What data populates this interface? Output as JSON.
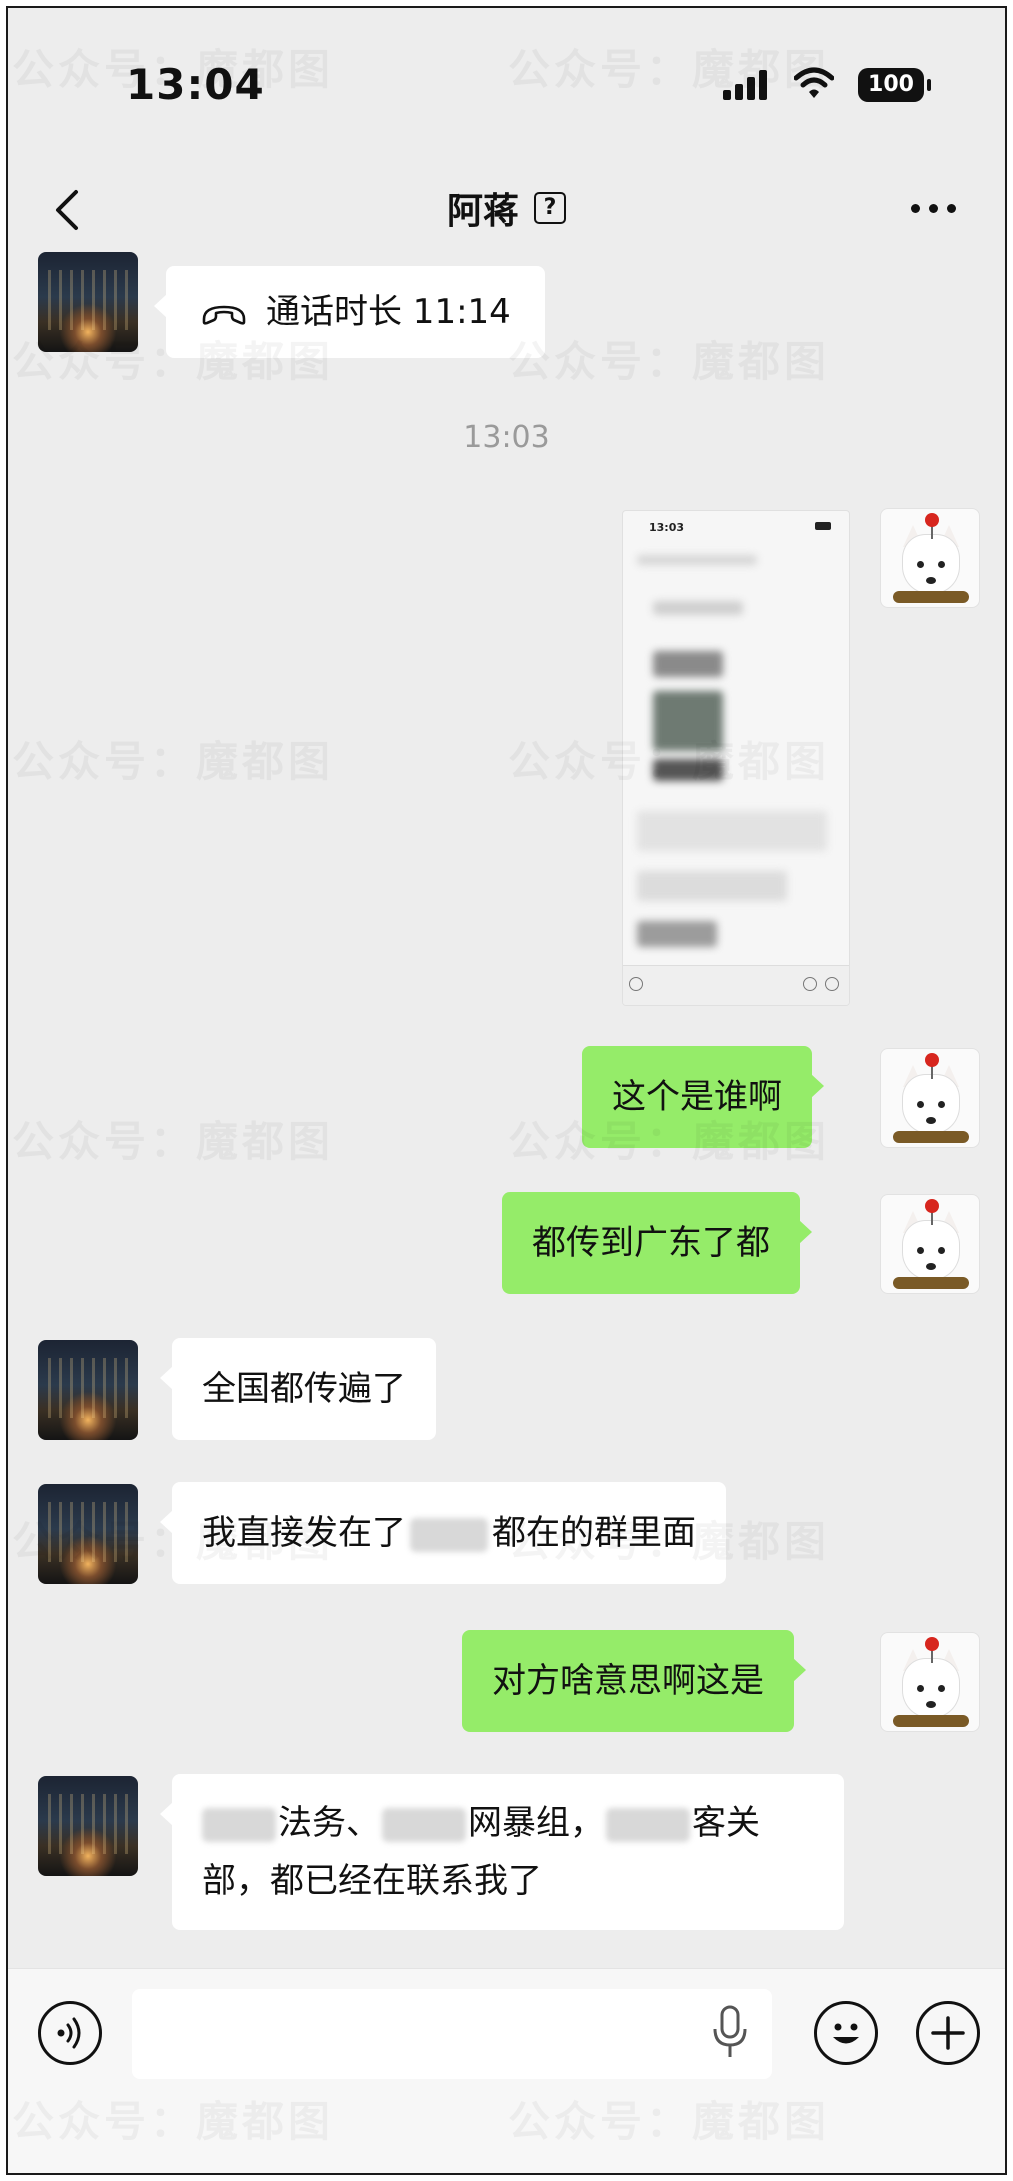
{
  "status_bar": {
    "time": "13:04",
    "battery": "100"
  },
  "nav": {
    "title": "阿蒋",
    "badge": "?"
  },
  "messages": {
    "call_record": "通话时长 11:14",
    "timestamp": "13:03",
    "screenshot_thumb_time": "13:03",
    "m1": "这个是谁啊",
    "m2": "都传到广东了都",
    "m3": "全国都传遍了",
    "m4_a": "我直接发在了",
    "m4_b": "都在的群里面",
    "m5": "对方啥意思啊这是",
    "m6_a": "法务、",
    "m6_b": "网暴组，",
    "m6_c": "客关",
    "m6_d": "部，都已经在联系我了"
  },
  "watermark": "公众号：魔都图",
  "colors": {
    "chat_background": "#ededed",
    "sent_bubble": "#95ec69",
    "received_bubble": "#ffffff",
    "timestamp_text": "#9a9a9a"
  },
  "icons": {
    "back": "chevron-left-icon",
    "more": "ellipsis-icon",
    "call": "phone-hangup-icon",
    "voice": "voice-mode-icon",
    "mic": "microphone-icon",
    "emoji": "smiley-icon",
    "plus": "plus-icon"
  }
}
